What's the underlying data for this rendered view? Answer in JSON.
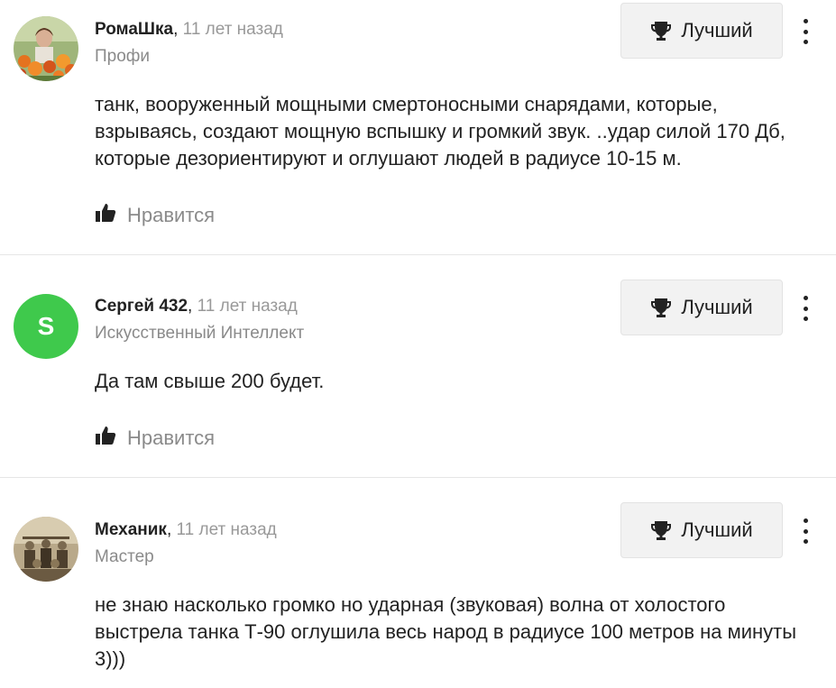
{
  "answers": [
    {
      "author": "РомаШка",
      "comma": ",",
      "time": " 11 лет назад",
      "rank": "Профи",
      "avatar_type": "photo-flowers",
      "text": "танк, вооруженный мощными смертоносными снарядами, которые, взрываясь, создают мощную вспышку и громкий звук. ..удар силой 170 Дб, которые дезориентируют и оглушают людей в радиусе 10-15 м.",
      "best_label": "Лучший",
      "like_label": "Нравится"
    },
    {
      "author": "Сергей 432",
      "comma": ",",
      "time": " 11 лет назад",
      "rank": "Искусственный Интеллект",
      "avatar_letter": "S",
      "avatar_color": "#3fc94c",
      "text": "Да там свыше 200 будет.",
      "best_label": "Лучший",
      "like_label": "Нравится"
    },
    {
      "author": "Механик",
      "comma": ",",
      "time": " 11 лет назад",
      "rank": "Мастер",
      "avatar_type": "photo-sepia-group",
      "text": "не знаю насколько громко но ударная (звуковая) волна от холостого выстрела танка Т-90 оглушила весь народ в радиусе 100 метров на минуты 3)))",
      "best_label": "Лучший"
    }
  ],
  "icons": {
    "best": "trophy-icon",
    "like": "thumbs-up-icon",
    "more": "more-vertical-icon"
  },
  "colors": {
    "divider": "#e6e6e6",
    "muted_text": "#8a8a8a",
    "button_bg": "#f2f2f2",
    "letter_avatar": "#3fc94c"
  }
}
